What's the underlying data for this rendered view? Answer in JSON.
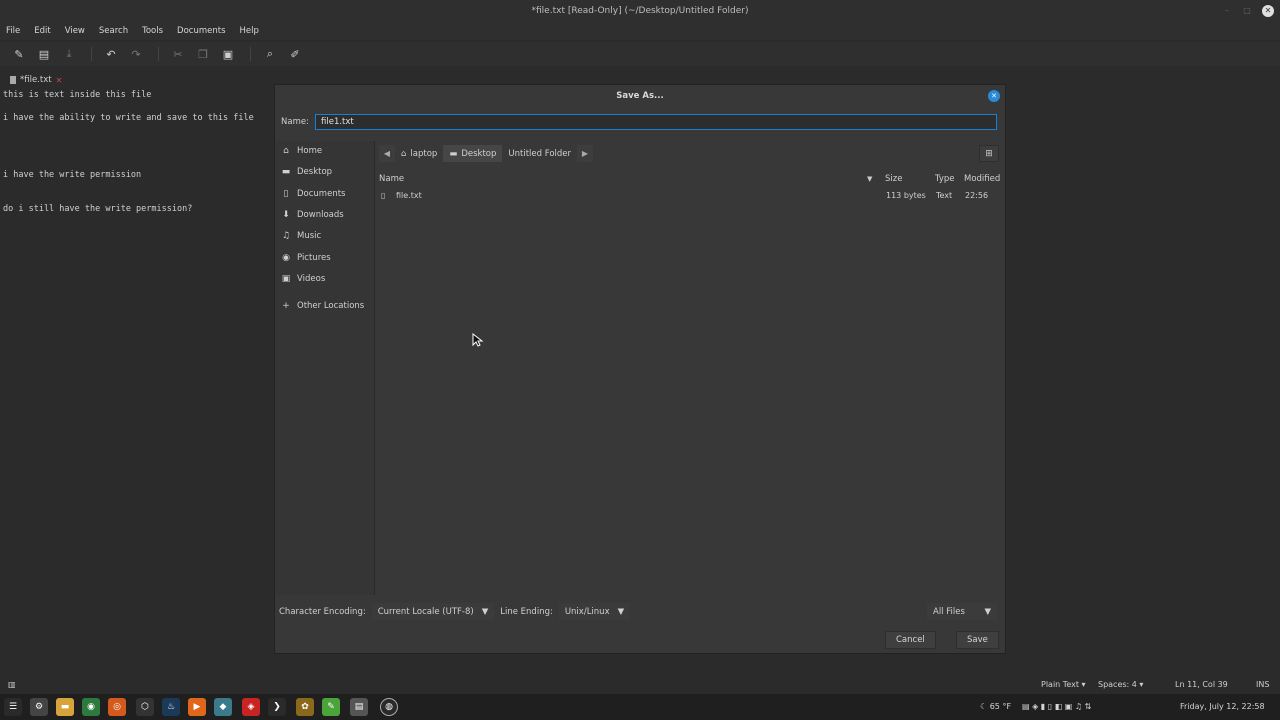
{
  "window": {
    "title": "*file.txt [Read-Only] (~/Desktop/Untitled Folder)"
  },
  "menu": {
    "items": [
      "File",
      "Edit",
      "View",
      "Search",
      "Tools",
      "Documents",
      "Help"
    ]
  },
  "toolbar": {
    "icons": [
      "new-document-icon",
      "open-icon",
      "save-icon",
      "undo-icon",
      "redo-icon",
      "cut-icon",
      "copy-icon",
      "paste-icon",
      "search-icon",
      "replace-icon"
    ]
  },
  "tab": {
    "label": "*file.txt"
  },
  "editor": {
    "lines": [
      "this is text inside this file",
      "i have the ability to write and save to this file",
      "i have the write permission",
      "do i still have the write permission?"
    ]
  },
  "dialog": {
    "title": "Save As...",
    "name_label": "Name:",
    "name_value": "file1.txt",
    "places": [
      "Home",
      "Desktop",
      "Documents",
      "Downloads",
      "Music",
      "Pictures",
      "Videos",
      "Other Locations"
    ],
    "path": [
      "laptop",
      "Desktop",
      "Untitled Folder"
    ],
    "columns": {
      "name": "Name",
      "size": "Size",
      "type": "Type",
      "modified": "Modified"
    },
    "files": [
      {
        "name": "file.txt",
        "size": "113 bytes",
        "type": "Text",
        "modified": "22:56"
      }
    ],
    "encoding_label": "Character Encoding:",
    "encoding_value": "Current Locale (UTF-8)",
    "line_ending_label": "Line Ending:",
    "line_ending_value": "Unix/Linux",
    "filter_value": "All Files",
    "cancel_label": "Cancel",
    "save_label": "Save"
  },
  "statusbar": {
    "language": "Plain Text",
    "spaces": "Spaces: 4",
    "position": "Ln 11, Col 39",
    "mode": "INS"
  },
  "taskbar": {
    "weather": "65 °F",
    "clock": "Friday, July 12, 22:58"
  }
}
